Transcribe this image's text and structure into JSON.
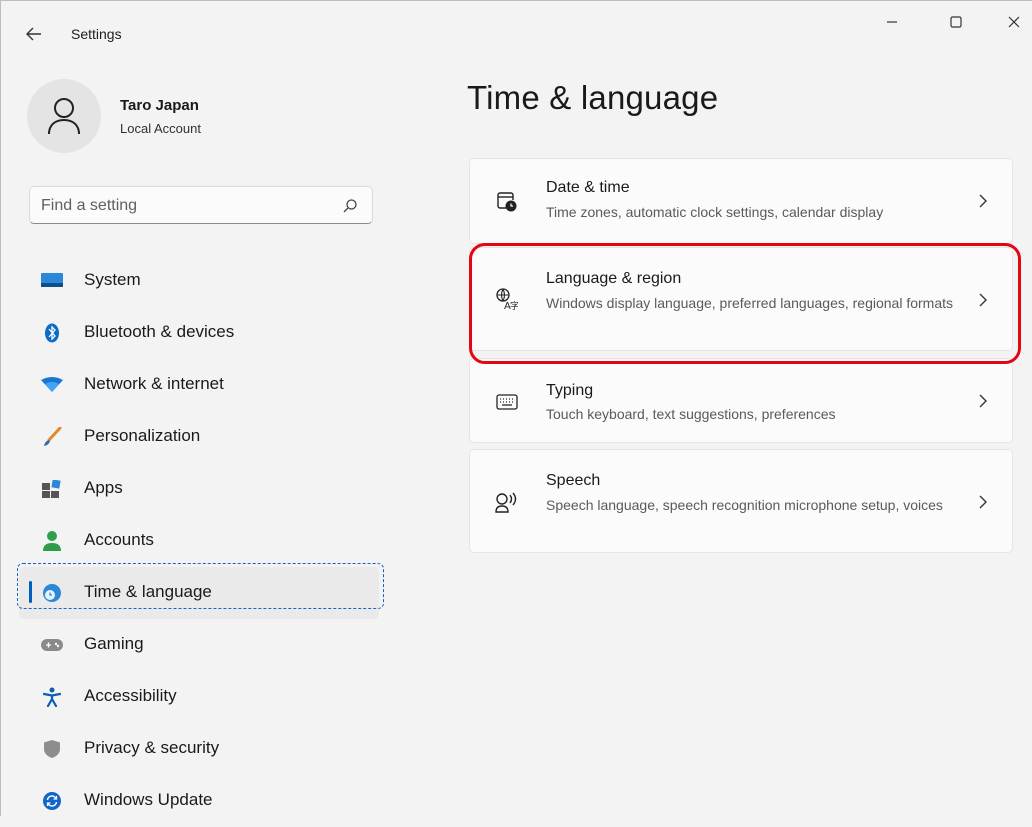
{
  "window": {
    "title": "Settings"
  },
  "profile": {
    "name": "Taro Japan",
    "account_type": "Local Account"
  },
  "search": {
    "placeholder": "Find a setting"
  },
  "nav": {
    "selected": "Time & language",
    "items": [
      {
        "label": "System",
        "icon": "monitor-icon"
      },
      {
        "label": "Bluetooth & devices",
        "icon": "bluetooth-icon"
      },
      {
        "label": "Network & internet",
        "icon": "wifi-icon"
      },
      {
        "label": "Personalization",
        "icon": "brush-icon"
      },
      {
        "label": "Apps",
        "icon": "apps-icon"
      },
      {
        "label": "Accounts",
        "icon": "person-icon"
      },
      {
        "label": "Time & language",
        "icon": "globe-clock-icon"
      },
      {
        "label": "Gaming",
        "icon": "gamepad-icon"
      },
      {
        "label": "Accessibility",
        "icon": "accessibility-icon"
      },
      {
        "label": "Privacy & security",
        "icon": "shield-icon"
      },
      {
        "label": "Windows Update",
        "icon": "update-icon"
      }
    ]
  },
  "main": {
    "title": "Time & language",
    "cards": [
      {
        "title": "Date & time",
        "description": "Time zones, automatic clock settings, calendar display",
        "icon": "calendar-clock-icon"
      },
      {
        "title": "Language & region",
        "description": "Windows display language, preferred languages, regional formats",
        "icon": "language-icon"
      },
      {
        "title": "Typing",
        "description": "Touch keyboard, text suggestions, preferences",
        "icon": "keyboard-icon"
      },
      {
        "title": "Speech",
        "description": "Speech language, speech recognition microphone setup, voices",
        "icon": "speech-icon"
      }
    ]
  },
  "colors": {
    "accent": "#005fb8",
    "highlight_red": "#e30613",
    "highlight_blue_dashed": "#1565c0"
  }
}
